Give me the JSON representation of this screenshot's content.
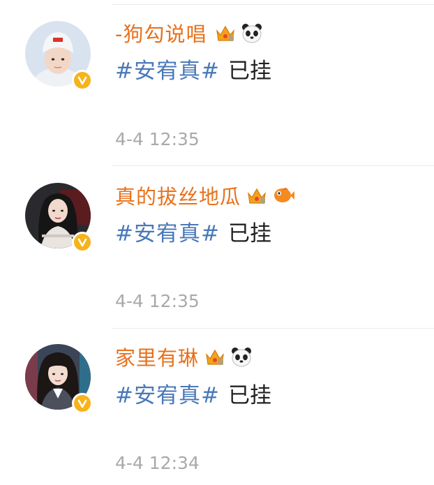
{
  "comments": [
    {
      "username": "-狗勾说唱",
      "badges": [
        "crown-badge-icon",
        "panda-emoji-icon"
      ],
      "topic": "#安宥真#",
      "text": "已挂",
      "time": "4-4 12:35"
    },
    {
      "username": "真的拔丝地瓜",
      "badges": [
        "crown-badge-icon",
        "fish-emoji-icon"
      ],
      "topic": "#安宥真#",
      "text": "已挂",
      "time": "4-4 12:35"
    },
    {
      "username": "家里有琳",
      "badges": [
        "crown-badge-icon",
        "panda-emoji-icon"
      ],
      "topic": "#安宥真#",
      "text": "已挂",
      "time": "4-4 12:34"
    }
  ],
  "colors": {
    "username": "#e8711c",
    "topic": "#4a78b8",
    "text": "#222222",
    "timestamp": "#a9a9a9",
    "verified": "#f6b31b"
  }
}
